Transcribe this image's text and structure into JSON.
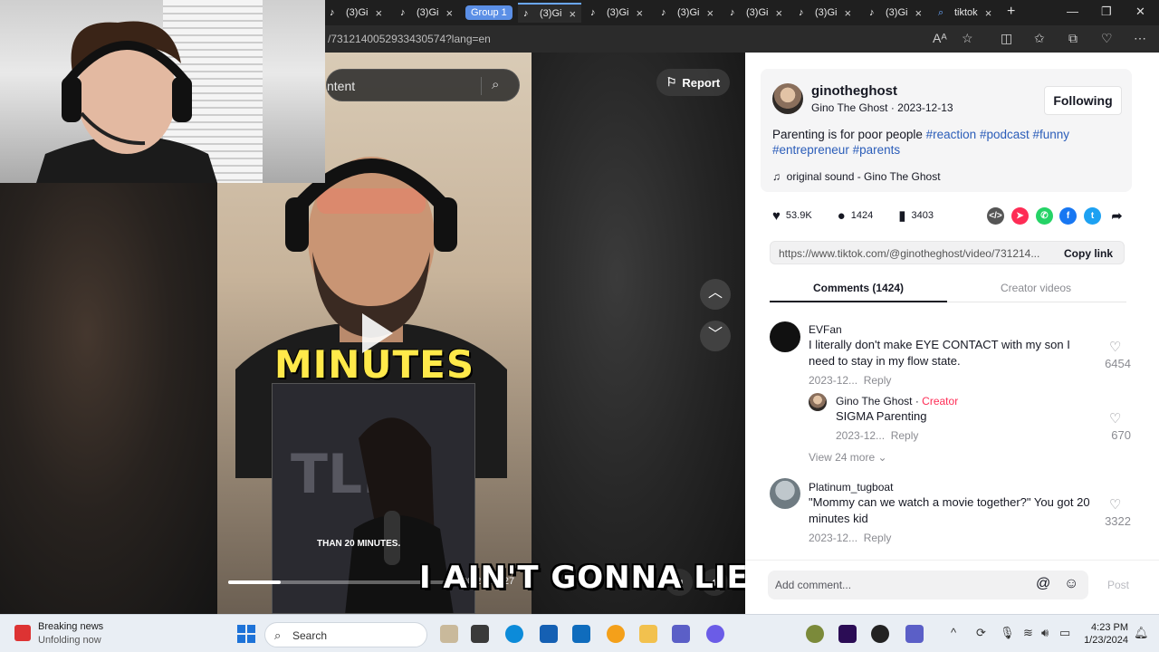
{
  "browser": {
    "tabs": [
      {
        "label": "(3)Gi"
      },
      {
        "label": "(3)Gi"
      },
      {
        "label": "(3)Gi"
      },
      {
        "label": "(3)Gi"
      },
      {
        "label": "(3)Gi"
      },
      {
        "label": "(3)Gi"
      },
      {
        "label": "(3)Gi"
      },
      {
        "label": "(3)Gi"
      }
    ],
    "group_label": "Group 1",
    "last_tab_label": "tiktok",
    "address_url": "/7312140052933430574?lang=en"
  },
  "tiktok": {
    "search_fragment": "ntent",
    "report_label": "Report",
    "video": {
      "caption_big": "MINUTES",
      "inset_caption": "THAN 20 MINUTES.",
      "subtitle": "I AIN'T GONNA LIE",
      "timecode": "00:21/01:27",
      "progress": 0.24
    },
    "post": {
      "username": "ginotheghost",
      "display_name": "Gino The Ghost",
      "date": "2023-12-13",
      "follow_label": "Following",
      "text": "Parenting is for poor people",
      "hashtags": [
        "#reaction",
        "#podcast",
        "#funny",
        "#entrepreneur",
        "#parents"
      ],
      "sound": "original sound - Gino The Ghost"
    },
    "stats": {
      "likes": "53.9K",
      "comments": "1424",
      "saves": "3403"
    },
    "share_colors": {
      "embed": "#555555",
      "direct": "#fe2c55",
      "whatsapp": "#25d366",
      "facebook": "#1877f2",
      "twitter": "#1da1f2"
    },
    "share_link": "https://www.tiktok.com/@ginotheghost/video/731214...",
    "copy_link_label": "Copy link",
    "tabs": {
      "comments": "Comments (1424)",
      "creator": "Creator videos"
    },
    "comments": [
      {
        "name": "EVFan",
        "text": "I literally don't make EYE CONTACT with my son I need to stay in my flow state.",
        "date": "2023-12...",
        "reply": "Reply",
        "likes": "6454"
      },
      {
        "name": "Platinum_tugboat",
        "text": "\"Mommy can we watch a movie together?\" You got 20 minutes kid",
        "date": "2023-12...",
        "reply": "Reply",
        "likes": "3322"
      }
    ],
    "creator_reply": {
      "name": "Gino The Ghost",
      "badge": "Creator",
      "text": "SIGMA Parenting",
      "date": "2023-12...",
      "reply": "Reply",
      "likes": "670"
    },
    "view_more": "View 24 more",
    "add_comment_placeholder": "Add comment...",
    "post_label": "Post"
  },
  "taskbar": {
    "news_title": "Breaking news",
    "news_sub": "Unfolding now",
    "search_label": "Search",
    "time": "4:23 PM",
    "date": "1/23/2024"
  }
}
